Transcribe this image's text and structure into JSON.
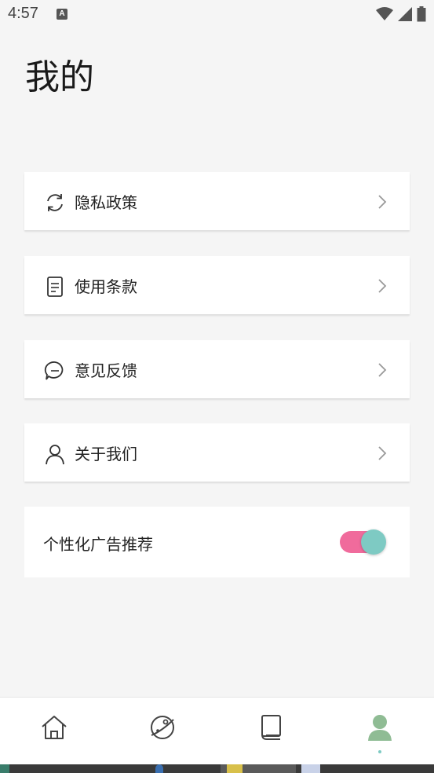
{
  "status_bar": {
    "time": "4:57",
    "notification_badge": "A"
  },
  "page": {
    "title": "我的"
  },
  "menu": [
    {
      "label": "隐私政策",
      "icon": "refresh-icon"
    },
    {
      "label": "使用条款",
      "icon": "document-icon"
    },
    {
      "label": "意见反馈",
      "icon": "chat-icon"
    },
    {
      "label": "关于我们",
      "icon": "user-icon"
    }
  ],
  "personalized_ads": {
    "label": "个性化广告推荐",
    "enabled": true
  },
  "bottom_nav": [
    {
      "icon": "home-icon",
      "active": false
    },
    {
      "icon": "explore-icon",
      "active": false
    },
    {
      "icon": "book-icon",
      "active": false
    },
    {
      "icon": "profile-icon",
      "active": true
    }
  ],
  "colors": {
    "toggle_track": "#f06b9c",
    "toggle_knob": "#7ecac3",
    "active_nav": "#8fbc94",
    "background": "#f5f5f5"
  }
}
